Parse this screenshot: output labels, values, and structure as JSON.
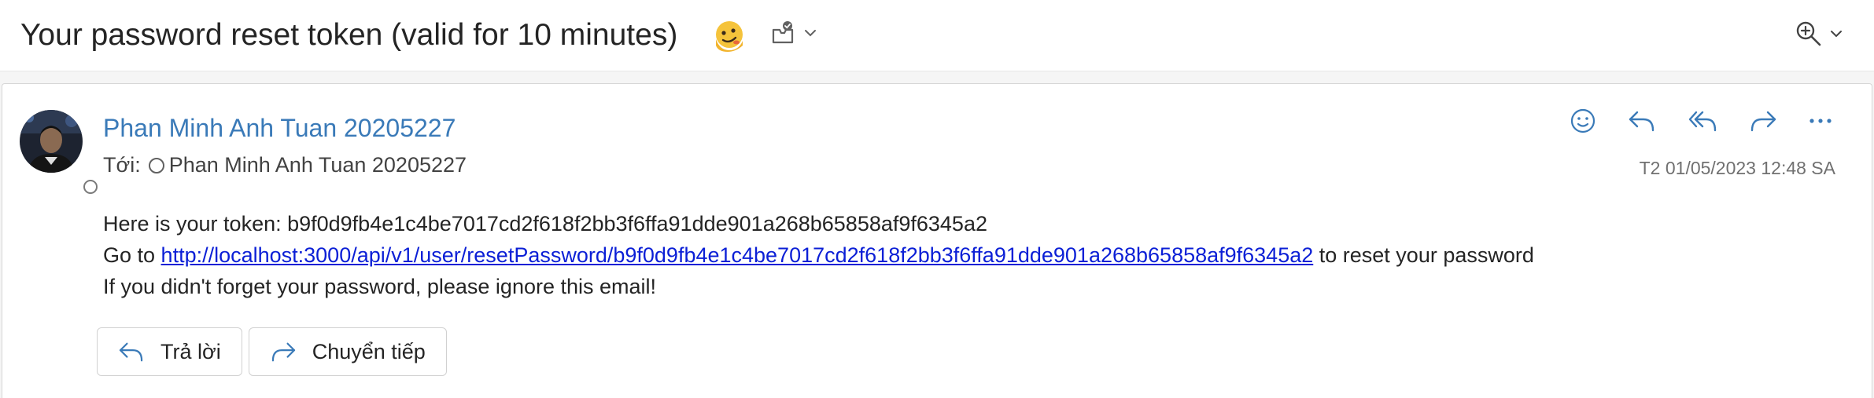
{
  "subject": {
    "title": "Your password reset token (valid for 10 minutes)",
    "emoji_icon": "melting-face-emoji",
    "mark_icon": "mailbox-check-icon",
    "zoom_icon": "zoom-in-icon"
  },
  "message": {
    "sender_name": "Phan Minh Anh Tuan 20205227",
    "to_label": "Tới:",
    "to_name": "Phan Minh Anh Tuan 20205227",
    "date": "T2 01/05/2023 12:48 SA",
    "actions": [
      "smiley-icon",
      "reply-icon",
      "reply-all-icon",
      "forward-icon",
      "more-icon"
    ],
    "body": {
      "line1": "Here is your token: b9f0d9fb4e1c4be7017cd2f618f2bb3f6ffa91dde901a268b65858af9f6345a2",
      "line2_prefix": "Go to ",
      "link": "http://localhost:3000/api/v1/user/resetPassword/b9f0d9fb4e1c4be7017cd2f618f2bb3f6ffa91dde901a268b65858af9f6345a2",
      "line2_suffix": " to reset your password",
      "line3": "If you didn't forget your password, please ignore this email!"
    },
    "reply_button": "Trả lời",
    "forward_button": "Chuyển tiếp"
  },
  "colors": {
    "sender": "#3a7ab8",
    "icon_blue": "#3a7ab8",
    "link": "#0b1fd6"
  }
}
